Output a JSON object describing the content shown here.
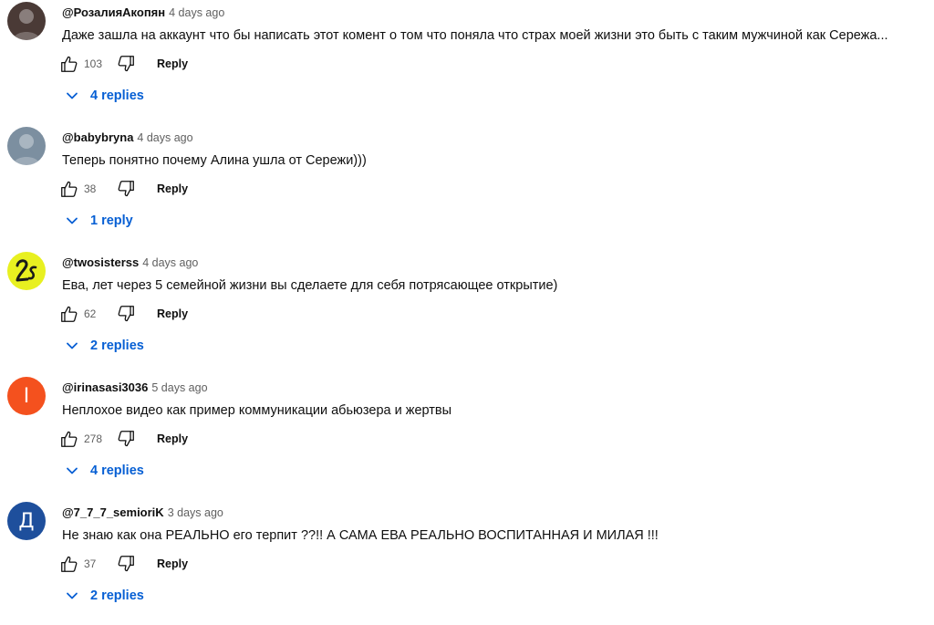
{
  "colors": {
    "link_blue": "#065fd4",
    "meta_gray": "#606060",
    "text": "#0f0f0f"
  },
  "icons": {
    "like": "thumb-up-icon",
    "dislike": "thumb-down-icon",
    "expand": "chevron-down-icon"
  },
  "comments": [
    {
      "author": "@РозалияАкопян",
      "date": "4 days ago",
      "text": "Даже зашла на аккаунт что бы написать этот комент о том что поняла что страх моей жизни это быть с таким мужчиной как Сережа...",
      "likes": "103",
      "reply_label": "Reply",
      "replies_label": "4 replies",
      "avatar": {
        "type": "photo",
        "color": "#4a3a36"
      }
    },
    {
      "author": "@babybryna",
      "date": "4 days ago",
      "text": "Теперь понятно почему Алина ушла от Сережи)))",
      "likes": "38",
      "reply_label": "Reply",
      "replies_label": "1 reply",
      "avatar": {
        "type": "photo",
        "color": "#7c8fa0"
      }
    },
    {
      "author": "@twosisterss",
      "date": "4 days ago",
      "text": "Ева, лет через 5 семейной жизни вы сделаете для себя потрясающее открытие)",
      "likes": "62",
      "reply_label": "Reply",
      "replies_label": "2 replies",
      "avatar": {
        "type": "logo",
        "color": "#e8f020"
      }
    },
    {
      "author": "@irinasasi3036",
      "date": "5 days ago",
      "text": "Неплохое видео как пример коммуникации абьюзера и жертвы",
      "likes": "278",
      "reply_label": "Reply",
      "replies_label": "4 replies",
      "avatar": {
        "type": "letter",
        "letter": "I",
        "color": "#f4511e"
      }
    },
    {
      "author": "@7_7_7_semioriK",
      "date": "3 days ago",
      "text": "Не знаю  как она РЕАЛЬНО его терпит ??!!  А САМА ЕВА РЕАЛЬНО ВОСПИТАННАЯ И МИЛАЯ !!!",
      "likes": "37",
      "reply_label": "Reply",
      "replies_label": "2 replies",
      "avatar": {
        "type": "letter",
        "letter": "Д",
        "color": "#1e4f9c"
      }
    }
  ]
}
